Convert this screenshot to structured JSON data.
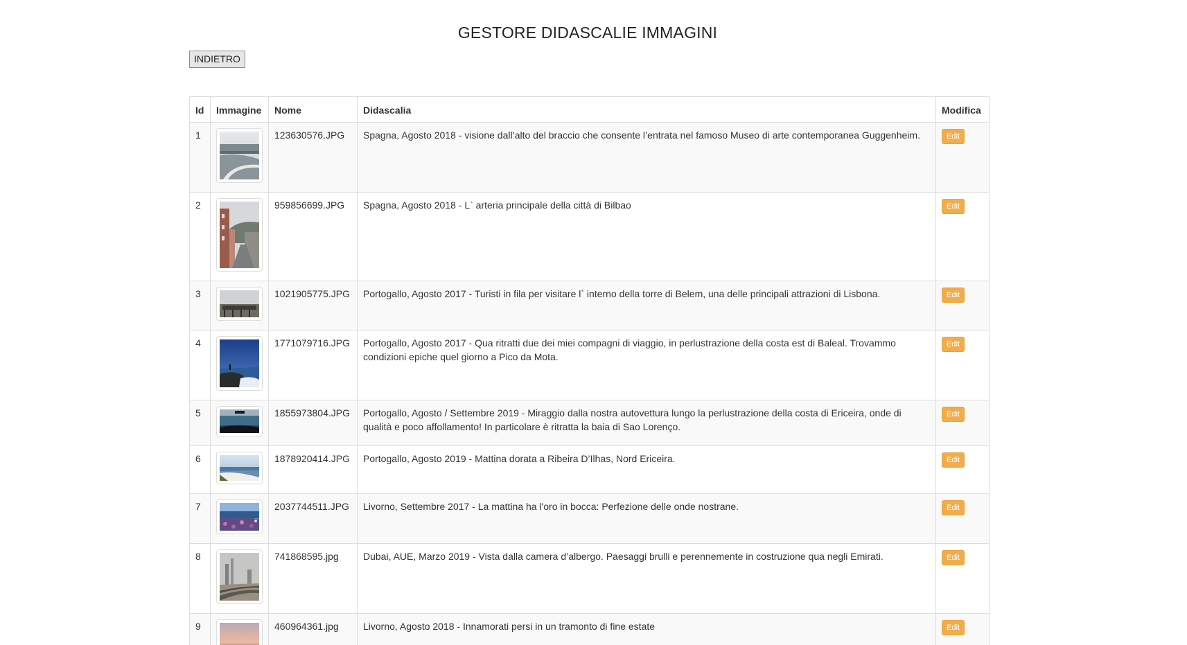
{
  "page": {
    "title": "GESTORE DIDASCALIE IMMAGINI",
    "back_label": "INDIETRO"
  },
  "table": {
    "headers": {
      "id": "Id",
      "image": "Immagine",
      "name": "Nome",
      "caption": "Didascalia",
      "edit": "Modifica"
    },
    "edit_label": "Edit",
    "rows": [
      {
        "id": "1",
        "name": "123630576.JPG",
        "caption": "Spagna, Agosto 2018 - visione dall’alto del braccio che consente l’entrata nel famoso Museo di arte contemporanea Guggenheim.",
        "thumb": "aerial-walkway"
      },
      {
        "id": "2",
        "name": "959856699.JPG",
        "caption": "Spagna, Agosto 2018 - L` arteria principale della città di Bilbao",
        "thumb": "city-street"
      },
      {
        "id": "3",
        "name": "1021905775.JPG",
        "caption": "Portogallo, Agosto 2017 - Turisti in fila per visitare l` interno della torre di Belem, una delle principali attrazioni di Lisbona.",
        "thumb": "tower-queue"
      },
      {
        "id": "4",
        "name": "1771079716.JPG",
        "caption": "Portogallo, Agosto 2017 - Qua ritratti due dei miei compagni di viaggio, in perlustrazione della costa est di Baleal. Trovammo condizioni epiche quel giorno a Pico da Mota.",
        "thumb": "coast-blue"
      },
      {
        "id": "5",
        "name": "1855973804.JPG",
        "caption": "Portogallo, Agosto / Settembre 2019 - Miraggio dalla nostra autovettura lungo la perlustrazione della costa di Ericeira, onde di qualità e poco affollamento! In particolare è ritratta la baia di Sao Lorenço.",
        "thumb": "car-sea"
      },
      {
        "id": "6",
        "name": "1878920414.JPG",
        "caption": "Portogallo, Agosto 2019 - Mattina dorata a Ribeira D’Ilhas, Nord Ericeira.",
        "thumb": "golden-morning"
      },
      {
        "id": "7",
        "name": "2037744511.JPG",
        "caption": "Livorno, Settembre 2017 - La mattina ha l'oro in bocca: Perfezione delle onde nostrane.",
        "thumb": "flowers-sea"
      },
      {
        "id": "8",
        "name": "741868595.jpg",
        "caption": "Dubai, AUE, Marzo 2019 - Vista dalla camera d’albergo. Paesaggi brulli e perennemente in costruzione qua negli Emirati.",
        "thumb": "desert-highway"
      },
      {
        "id": "9",
        "name": "460964361.jpg",
        "caption": "Livorno, Agosto 2018 - Innamorati persi in un tramonto di fine estate",
        "thumb": "sunset"
      }
    ]
  }
}
